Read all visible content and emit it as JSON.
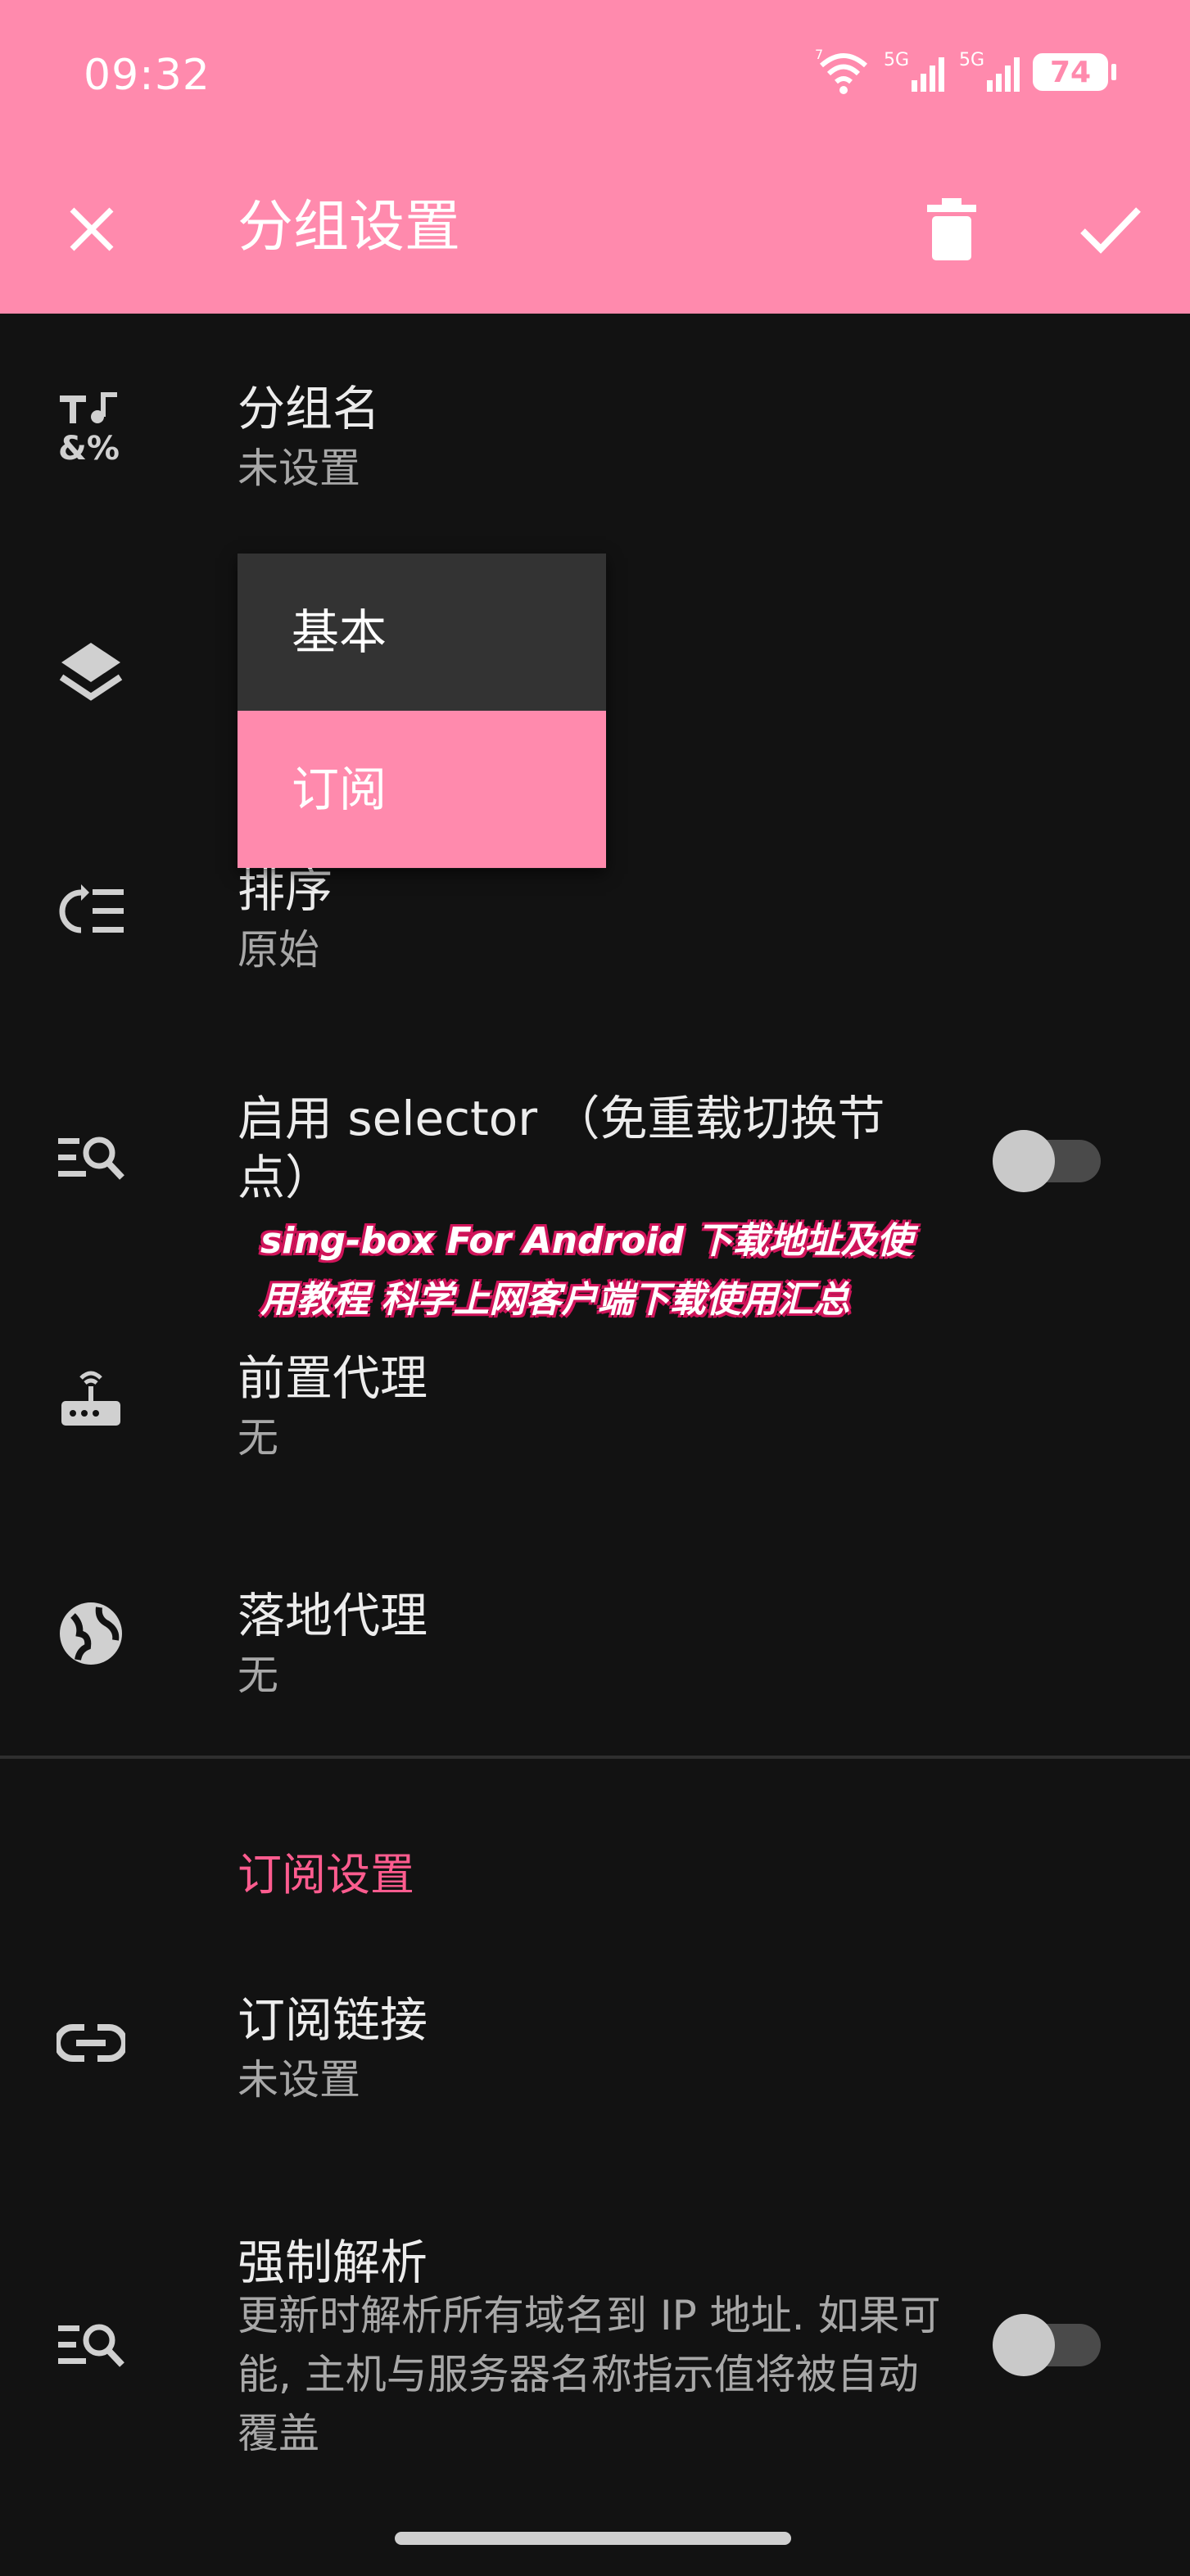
{
  "status_bar": {
    "time": "09:32",
    "battery": "74",
    "signal_label_1": "5G",
    "signal_label_2": "5G",
    "wifi_label": "7"
  },
  "app_bar": {
    "title": "分组设置"
  },
  "settings": [
    {
      "title": "分组名",
      "summary": "未设置"
    },
    {
      "title": "排序",
      "summary": "原始"
    },
    {
      "title": "启用 selector （免重载切换节点）"
    },
    {
      "title": "前置代理",
      "summary": "无"
    },
    {
      "title": "落地代理",
      "summary": "无"
    }
  ],
  "dropdown": {
    "options": [
      "基本",
      "订阅"
    ],
    "selected": "订阅"
  },
  "subscription_section": {
    "header": "订阅设置",
    "items": [
      {
        "title": "订阅链接",
        "summary": "未设置"
      },
      {
        "title": "强制解析",
        "summary": "更新时解析所有域名到 IP 地址. 如果可能, 主机与服务器名称指示值将被自动覆盖"
      }
    ]
  },
  "watermark": {
    "text": "sing-box For Android 下载地址及使用教程 科学上网客户端下载使用汇总"
  },
  "colors": {
    "accent": "#ff8aad",
    "section": "#ff5c8f",
    "background": "#121212"
  }
}
